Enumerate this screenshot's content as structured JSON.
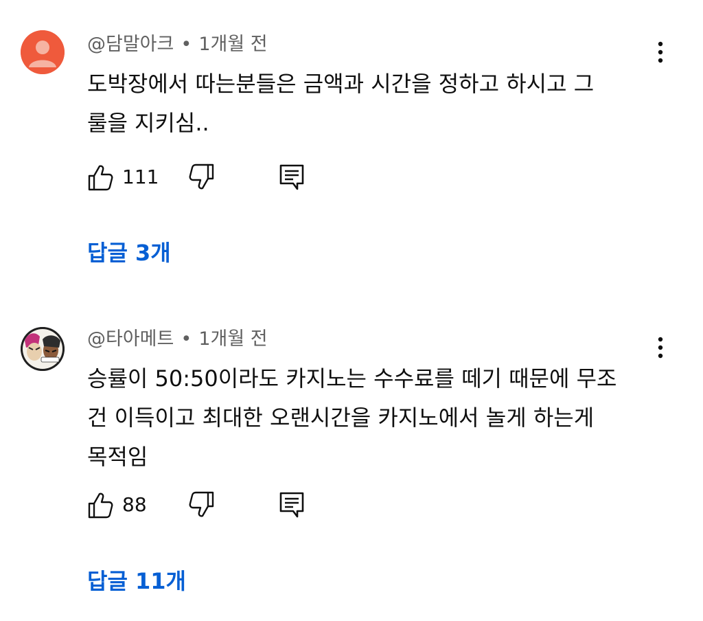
{
  "comments": [
    {
      "handle": "@담말아크",
      "separator": "•",
      "time": "1개월 전",
      "text_lines": [
        "도박장에서 따는분들은 금액과 시간을 정하고 하시고 그",
        "룰을 지키심.."
      ],
      "likes": "111",
      "replies_label": "답글 3개",
      "avatar_color": "#ef5a3c"
    },
    {
      "handle": "@타아메트",
      "separator": "•",
      "time": "1개월 전",
      "text_lines": [
        "승률이 50:50이라도 카지노는 수수료를 떼기 때문에 무조",
        "건 이득이고 최대한 오랜시간을 카지노에서 놀게 하는게",
        "목적임"
      ],
      "likes": "88",
      "replies_label": "답글 11개"
    }
  ],
  "colors": {
    "accent": "#065fd4",
    "meta": "#606060",
    "text": "#0f0f0f"
  },
  "icons": [
    "more-vert-icon",
    "thumb-up-icon",
    "thumb-down-icon",
    "reply-icon",
    "default-avatar-icon"
  ]
}
